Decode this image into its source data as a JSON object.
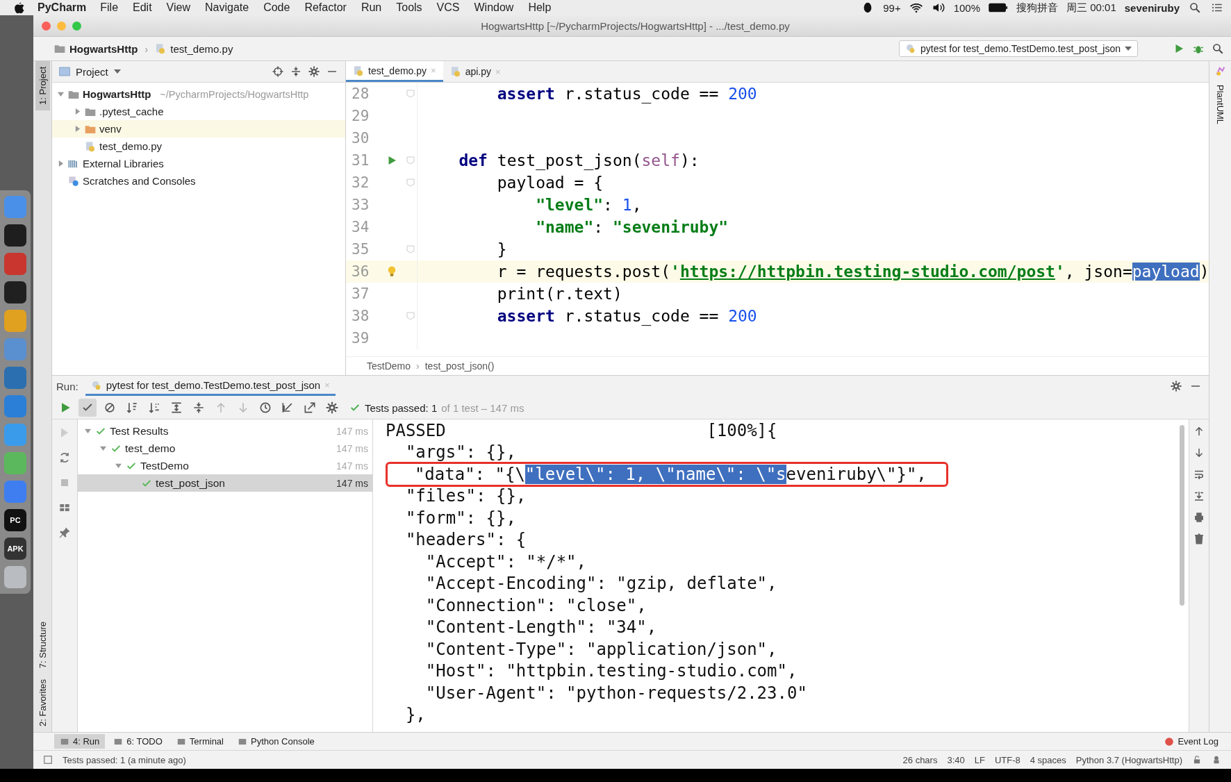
{
  "menubar": {
    "app": "PyCharm",
    "menus": [
      "File",
      "Edit",
      "View",
      "Navigate",
      "Code",
      "Refactor",
      "Run",
      "Tools",
      "VCS",
      "Window",
      "Help"
    ],
    "notifications": "99+",
    "battery": "100%",
    "input_method": "搜狗拼音",
    "clock": "周三 00:01",
    "user": "seveniruby"
  },
  "dock": [
    {
      "color": "#4a90e8"
    },
    {
      "color": "#1e1e1e"
    },
    {
      "color": "#c8362f"
    },
    {
      "color": "#202020"
    },
    {
      "color": "#e0a020"
    },
    {
      "color": "#5a8fd0"
    },
    {
      "color": "#2b6fb0"
    },
    {
      "color": "#2c7fd6"
    },
    {
      "color": "#3a9bea"
    },
    {
      "color": "#5cb85c"
    },
    {
      "color": "#3f7ef0"
    },
    {
      "color": "#111111",
      "label": "PC"
    },
    {
      "color": "#333333",
      "label": "APK"
    },
    {
      "color": "#b9bcc0"
    }
  ],
  "window": {
    "title": "HogwartsHttp [~/PycharmProjects/HogwartsHttp] - .../test_demo.py"
  },
  "navbar": {
    "crumbs": [
      "HogwartsHttp",
      "test_demo.py"
    ],
    "separator": "›",
    "run_config": "pytest for test_demo.TestDemo.test_post_json"
  },
  "tool_strips": {
    "left_top": "1: Project",
    "left_bottom": [
      "7: Structure",
      "2: Favorites"
    ],
    "right": "PlantUML"
  },
  "project": {
    "title": "Project",
    "tree": [
      {
        "label": "HogwartsHttp",
        "hint": "~/PycharmProjects/HogwartsHttp",
        "kind": "module",
        "expanded": true,
        "children": [
          {
            "label": ".pytest_cache",
            "kind": "folder",
            "expanded": false
          },
          {
            "label": "venv",
            "kind": "excluded",
            "expanded": false
          },
          {
            "label": "test_demo.py",
            "kind": "file"
          }
        ]
      },
      {
        "label": "External Libraries",
        "kind": "library",
        "expanded": false
      },
      {
        "label": "Scratches and Consoles",
        "kind": "scratches"
      }
    ]
  },
  "editor": {
    "tabs": [
      {
        "label": "test_demo.py",
        "selected": true,
        "close": "×"
      },
      {
        "label": "api.py",
        "selected": false,
        "close": "×"
      }
    ],
    "lines": [
      {
        "number": "28",
        "fold": true,
        "current": false,
        "tokens": [
          {
            "text": "        assert",
            "kind": "keyword"
          },
          {
            "text": " r.status_code == ",
            "kind": "plain"
          },
          {
            "text": "200",
            "kind": "number"
          }
        ]
      },
      {
        "number": "29",
        "fold": false,
        "current": false
      },
      {
        "number": "30",
        "fold": false,
        "current": false
      },
      {
        "number": "31",
        "fold": true,
        "current": false,
        "marker": {
          "kind": "run"
        },
        "tokens": [
          {
            "text": "    def",
            "kind": "keyword"
          },
          {
            "text": " test_post_json(",
            "kind": "plain"
          },
          {
            "text": "self",
            "kind": "self"
          },
          {
            "text": "):",
            "kind": "plain"
          }
        ]
      },
      {
        "number": "32",
        "fold": true,
        "current": false,
        "tokens": [
          {
            "text": "        payload = {",
            "kind": "plain"
          }
        ]
      },
      {
        "number": "33",
        "fold": false,
        "current": false,
        "tokens": [
          {
            "text": "            \"level\"",
            "kind": "string"
          },
          {
            "text": ": ",
            "kind": "plain"
          },
          {
            "text": "1",
            "kind": "number"
          },
          {
            "text": ",",
            "kind": "plain"
          }
        ]
      },
      {
        "number": "34",
        "fold": false,
        "current": false,
        "tokens": [
          {
            "text": "            \"name\"",
            "kind": "string"
          },
          {
            "text": ": ",
            "kind": "plain"
          },
          {
            "text": "\"seveniruby\"",
            "kind": "string"
          }
        ]
      },
      {
        "number": "35",
        "fold": true,
        "current": false,
        "tokens": [
          {
            "text": "        }",
            "kind": "plain"
          }
        ]
      },
      {
        "number": "36",
        "fold": false,
        "current": true,
        "marker": {
          "kind": "bulb"
        },
        "tokens": [
          {
            "text": "        r = requests.post(",
            "kind": "plain"
          },
          {
            "text": "'",
            "kind": "string"
          },
          {
            "text": "https://httpbin.testing-studio.com/post",
            "kind": "link"
          },
          {
            "text": "'",
            "kind": "string"
          },
          {
            "text": ", json=",
            "kind": "plain"
          },
          {
            "text": "payload",
            "kind": "selected"
          },
          {
            "text": ")",
            "kind": "plain"
          }
        ]
      },
      {
        "number": "37",
        "fold": false,
        "current": false,
        "tokens": [
          {
            "text": "        print(r.text)",
            "kind": "plain"
          }
        ]
      },
      {
        "number": "38",
        "fold": true,
        "current": false,
        "tokens": [
          {
            "text": "        assert",
            "kind": "keyword"
          },
          {
            "text": " r.status_code == ",
            "kind": "plain"
          },
          {
            "text": "200",
            "kind": "number"
          }
        ]
      },
      {
        "number": "39",
        "fold": false,
        "current": false
      }
    ],
    "breadcrumb": [
      "TestDemo",
      "test_post_json()"
    ],
    "breadcrumb_separator": "›"
  },
  "run": {
    "label": "Run:",
    "tab": {
      "label": "pytest for test_demo.TestDemo.test_post_json",
      "close": "×"
    },
    "summary": "Tests passed: 1",
    "summary_detail": "of 1 test – 147 ms",
    "tree": [
      {
        "label": "Test Results",
        "time": "147 ms",
        "passed": true,
        "expanded": true,
        "selected": false,
        "children": [
          {
            "label": "test_demo",
            "time": "147 ms",
            "passed": true,
            "expanded": true,
            "selected": false,
            "children": [
              {
                "label": "TestDemo",
                "time": "147 ms",
                "passed": true,
                "expanded": true,
                "selected": false,
                "children": [
                  {
                    "label": "test_post_json",
                    "time": "147 ms",
                    "passed": true,
                    "selected": true
                  }
                ]
              }
            ]
          }
        ]
      }
    ],
    "output": [
      {
        "boxed": false,
        "tokens": [
          {
            "text": "PASSED                          [100%]{",
            "kind": "plain"
          }
        ]
      },
      {
        "boxed": false,
        "tokens": [
          {
            "text": "  \"args\": {},",
            "kind": "plain"
          }
        ]
      },
      {
        "boxed": true,
        "tokens": [
          {
            "text": "  \"data\": \"{\\",
            "kind": "plain"
          },
          {
            "text": "\"level\\\": 1, \\\"name\\\": \\\"s",
            "kind": "selected"
          },
          {
            "text": "eveniruby\\\"}\",",
            "kind": "plain"
          }
        ]
      },
      {
        "boxed": false,
        "tokens": [
          {
            "text": "  \"files\": {},",
            "kind": "plain"
          }
        ]
      },
      {
        "boxed": false,
        "tokens": [
          {
            "text": "  \"form\": {},",
            "kind": "plain"
          }
        ]
      },
      {
        "boxed": false,
        "tokens": [
          {
            "text": "  \"headers\": {",
            "kind": "plain"
          }
        ]
      },
      {
        "boxed": false,
        "tokens": [
          {
            "text": "    \"Accept\": \"*/*\",",
            "kind": "plain"
          }
        ]
      },
      {
        "boxed": false,
        "tokens": [
          {
            "text": "    \"Accept-Encoding\": \"gzip, deflate\",",
            "kind": "plain"
          }
        ]
      },
      {
        "boxed": false,
        "tokens": [
          {
            "text": "    \"Connection\": \"close\",",
            "kind": "plain"
          }
        ]
      },
      {
        "boxed": false,
        "tokens": [
          {
            "text": "    \"Content-Length\": \"34\",",
            "kind": "plain"
          }
        ]
      },
      {
        "boxed": false,
        "tokens": [
          {
            "text": "    \"Content-Type\": \"application/json\",",
            "kind": "plain"
          }
        ]
      },
      {
        "boxed": false,
        "tokens": [
          {
            "text": "    \"Host\": \"httpbin.testing-studio.com\",",
            "kind": "plain"
          }
        ]
      },
      {
        "boxed": false,
        "tokens": [
          {
            "text": "    \"User-Agent\": \"python-requests/2.23.0\"",
            "kind": "plain"
          }
        ]
      },
      {
        "boxed": false,
        "tokens": [
          {
            "text": "  },",
            "kind": "plain"
          }
        ]
      }
    ]
  },
  "toolwindows": [
    {
      "label": "4: Run",
      "selected": true
    },
    {
      "label": "6: TODO",
      "selected": false
    },
    {
      "label": "Terminal",
      "selected": false
    },
    {
      "label": "Python Console",
      "selected": false
    }
  ],
  "event_log": "Event Log",
  "status": {
    "message": "Tests passed: 1 (a minute ago)",
    "items": [
      "26 chars",
      "3:40",
      "LF",
      "UTF-8",
      "4 spaces",
      "Python 3.7 (HogwartsHttp)"
    ]
  }
}
